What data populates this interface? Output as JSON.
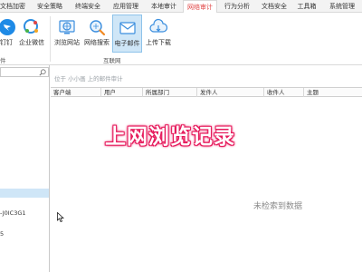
{
  "menu": {
    "tabs": [
      {
        "label": "文档加密"
      },
      {
        "label": "安全策略"
      },
      {
        "label": "终端安全"
      },
      {
        "label": "应用管理"
      },
      {
        "label": "本地审计"
      },
      {
        "label": "网络审计"
      },
      {
        "label": "行为分析"
      },
      {
        "label": "文档安全"
      },
      {
        "label": "工具箱"
      },
      {
        "label": "系统管理"
      }
    ],
    "active": "网络审计"
  },
  "ribbon": {
    "buttons": [
      {
        "label": "钉钉",
        "icon": "dingtalk-icon"
      },
      {
        "label": "企业微信",
        "icon": "wecom-icon"
      },
      {
        "label": "浏览网站",
        "icon": "browse-website-icon"
      },
      {
        "label": "网络搜索",
        "icon": "web-search-icon"
      },
      {
        "label": "电子邮件",
        "icon": "email-icon"
      },
      {
        "label": "上传下载",
        "icon": "upload-download-icon"
      }
    ],
    "groups": [
      {
        "label": "件"
      },
      {
        "label": "互联网"
      }
    ]
  },
  "left_panel": {
    "search_placeholder": "",
    "tree_items": [
      {
        "label": "-J0IC3G1"
      },
      {
        "label": "5"
      }
    ]
  },
  "main": {
    "filter_text": "位于  小小画 上的邮件审计",
    "columns": [
      "客户端",
      "用户",
      "所属部门",
      "发件人",
      "收件人",
      "主题"
    ],
    "empty_text": "未检索到数据"
  },
  "overlay": {
    "title": "上网浏览记录"
  },
  "colors": {
    "accent_red": "#e04545",
    "selected_bg": "#cfe6f7",
    "overlay_glow": "#e61a5c"
  }
}
